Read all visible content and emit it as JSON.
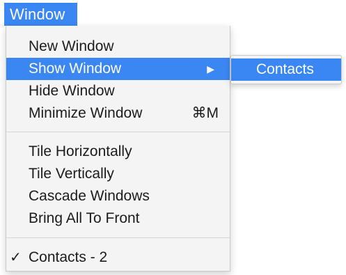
{
  "menubar": {
    "title": "Window"
  },
  "menu": {
    "items": [
      {
        "label": "New Window"
      },
      {
        "label": "Show Window",
        "submenu_arrow": "▶"
      },
      {
        "label": "Hide Window"
      },
      {
        "label": "Minimize Window",
        "shortcut": "⌘M"
      },
      {
        "label": "Tile Horizontally"
      },
      {
        "label": "Tile Vertically"
      },
      {
        "label": "Cascade Windows"
      },
      {
        "label": "Bring All To Front"
      },
      {
        "label": "Contacts - 2",
        "check": "✓"
      }
    ]
  },
  "submenu": {
    "items": [
      {
        "label": "Contacts"
      }
    ]
  },
  "colors": {
    "highlight": "#3a86f2",
    "menu_background": "#f4f4f4",
    "text": "#1c1c1c"
  }
}
